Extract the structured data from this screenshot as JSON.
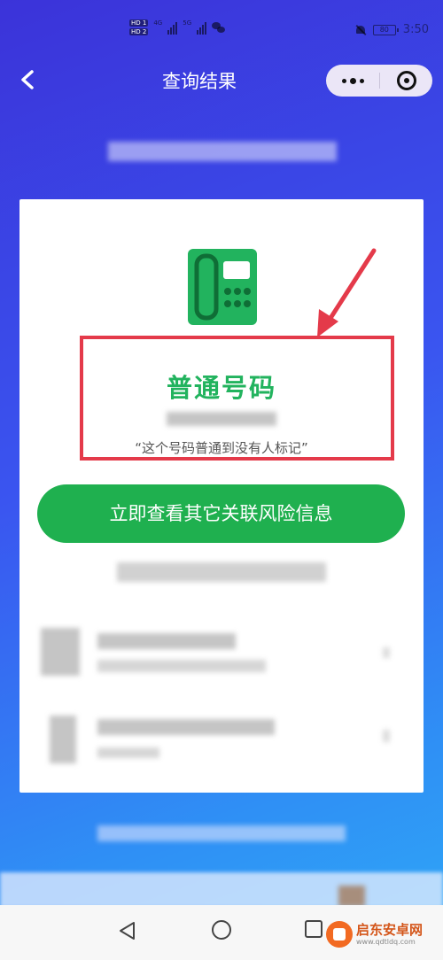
{
  "status_bar": {
    "hd_badges": [
      "HD 1",
      "HD 2"
    ],
    "net_labels": [
      "4G",
      "5G"
    ],
    "battery": "80",
    "time": "3:50"
  },
  "nav": {
    "title": "查询结果"
  },
  "result": {
    "title": "普通号码",
    "quote": "“这个号码普通到没有人标记”",
    "accent_color": "#22b35e",
    "highlight_color": "#e43a4a"
  },
  "cta": {
    "label": "立即查看其它关联风险信息",
    "color": "#1fb04f"
  },
  "icons": {
    "phone": "desk-phone-icon",
    "arrow": "red-arrow-icon"
  },
  "watermark": {
    "title": "启东安卓网",
    "url": "www.qdtldq.com"
  }
}
